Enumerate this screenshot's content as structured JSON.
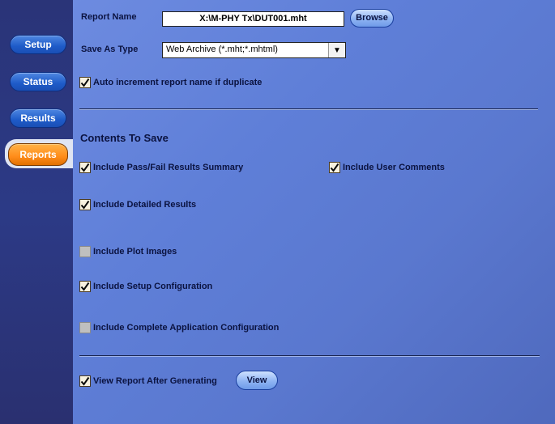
{
  "sidebar": {
    "items": [
      {
        "label": "Setup"
      },
      {
        "label": "Status"
      },
      {
        "label": "Results"
      },
      {
        "label": "Reports",
        "active": true
      }
    ]
  },
  "report": {
    "name_label": "Report Name",
    "name_value": "X:\\M-PHY Tx\\DUT001.mht",
    "browse_label": "Browse",
    "save_as_label": "Save As Type",
    "save_as_value": "Web Archive (*.mht;*.mhtml)",
    "save_as_arrow": "▼",
    "auto_increment_label": "Auto increment report name if duplicate",
    "auto_increment_checked": true
  },
  "contents": {
    "title": "Contents To Save",
    "options": {
      "pass_fail": {
        "label": "Include Pass/Fail Results Summary",
        "checked": true
      },
      "user_comments": {
        "label": "Include User Comments",
        "checked": true
      },
      "detailed": {
        "label": "Include Detailed Results",
        "checked": true
      },
      "plot_images": {
        "label": "Include Plot Images",
        "checked": false
      },
      "setup_config": {
        "label": "Include Setup Configuration",
        "checked": true
      },
      "complete_config": {
        "label": "Include Complete Application Configuration",
        "checked": false
      }
    }
  },
  "view": {
    "after_label": "View Report After Generating",
    "after_checked": true,
    "view_button": "View"
  },
  "colors": {
    "panel": "#5f7fd8",
    "sidebar": "#2c3a86",
    "active_tab": "#ff8c1a",
    "nav_button": "#1e5bc8"
  }
}
